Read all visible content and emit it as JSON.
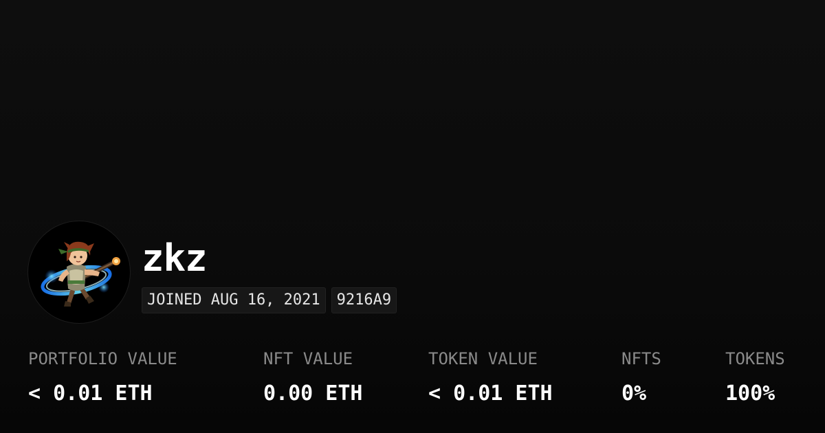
{
  "profile": {
    "username": "zkz",
    "joined": "JOINED AUG 16, 2021",
    "color_code": "9216A9",
    "avatar_icon": "anime-warrior-avatar"
  },
  "stats": [
    {
      "label": "PORTFOLIO VALUE",
      "value": "< 0.01 ETH"
    },
    {
      "label": "NFT VALUE",
      "value": "0.00 ETH"
    },
    {
      "label": "TOKEN VALUE",
      "value": "< 0.01 ETH"
    },
    {
      "label": "NFTS",
      "value": "0%"
    },
    {
      "label": "TOKENS",
      "value": "100%"
    }
  ],
  "colors": {
    "background": "#0b0b0b",
    "label": "#8a8a8a",
    "value": "#ffffff",
    "badge_bg": "#171717"
  }
}
